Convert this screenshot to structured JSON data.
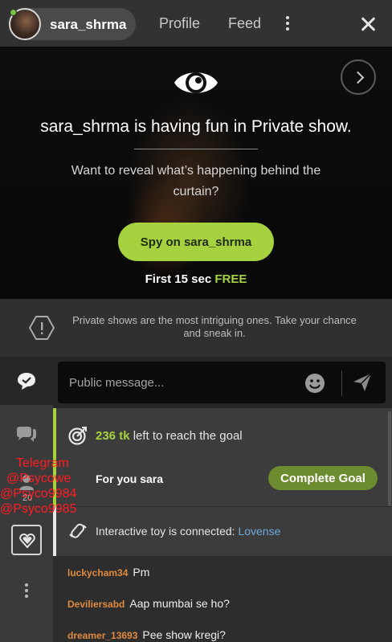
{
  "header": {
    "username": "sara_shrma",
    "tabs": [
      {
        "label": "Profile"
      },
      {
        "label": "Feed"
      }
    ]
  },
  "hero": {
    "title": "sara_shrma is having fun in Private show.",
    "subtitle": "Want to reveal what’s happening behind the curtain?",
    "spy_button": "Spy on sara_shrma",
    "free_prefix": "First 15 sec ",
    "free_highlight": "FREE"
  },
  "info": {
    "text": "Private shows are the most intriguing ones. Take your chance and sneak in."
  },
  "rail": {
    "viewers": "20"
  },
  "input": {
    "placeholder": "Public message..."
  },
  "goal": {
    "tokens": "236 tk",
    "rest": " left to reach the goal",
    "for_label": "For you sara",
    "complete_button": "Complete Goal"
  },
  "toy": {
    "text": "Interactive toy is connected: ",
    "brand": "Lovense"
  },
  "chat": {
    "messages": [
      {
        "user": "luckycham34",
        "text": "Pm"
      },
      {
        "user": "Deviliersabd",
        "text": "Aap mumbai se ho?"
      },
      {
        "user": "dreamer_13693",
        "text": "Pee show kregi?"
      }
    ]
  },
  "watermark": {
    "lines": [
      "Telegram",
      "@Psycowe",
      "@Psyco9984",
      "@Psyco9985"
    ]
  },
  "colors": {
    "accent": "#a6d23f",
    "chat_user": "#e08a3e",
    "link": "#6fa8dc",
    "watermark": "#ff1c24"
  }
}
